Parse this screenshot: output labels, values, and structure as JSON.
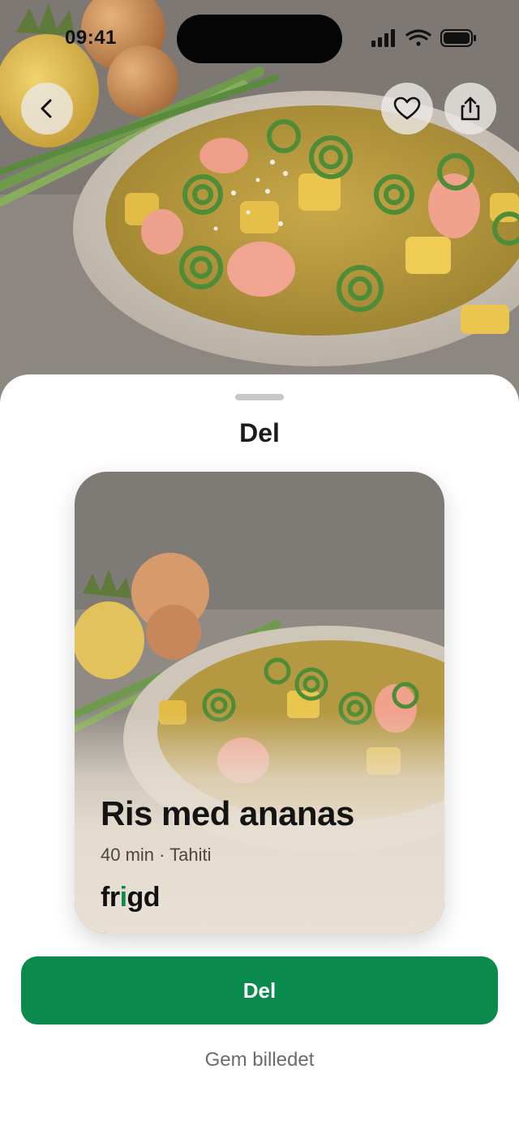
{
  "status_bar": {
    "time": "09:41"
  },
  "hero": {
    "photo_icon": "rice-pineapple-dish-photo",
    "back_icon": "chevron-left-icon",
    "favorite_icon": "heart-icon",
    "share_icon": "share-icon"
  },
  "sheet": {
    "title": "Del",
    "card": {
      "title": "Ris med ananas",
      "meta": "40 min · Tahiti",
      "brand_before": "fr",
      "brand_accent": "i",
      "brand_after": "gd"
    },
    "primary_button": "Del",
    "secondary_link": "Gem billedet"
  },
  "colors": {
    "brand_green": "#0a8a4c",
    "sheet_background": "#ffffff",
    "card_fade": "#e9e0d4"
  }
}
